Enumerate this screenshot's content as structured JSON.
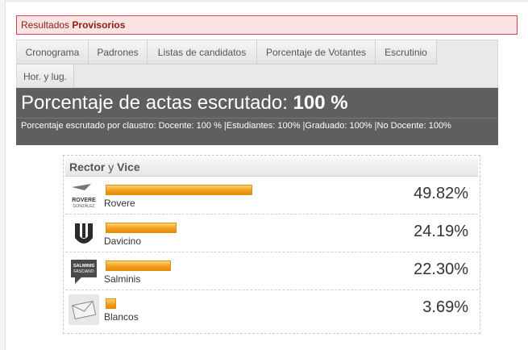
{
  "alert": {
    "prefix": "Resultados",
    "bold": "Provisorios"
  },
  "tabs": [
    {
      "label": "Cronograma"
    },
    {
      "label": "Padrones"
    },
    {
      "label": "Listas de candidatos"
    },
    {
      "label": "Porcentaje de Votantes"
    },
    {
      "label": "Escrutinio"
    },
    {
      "label": "Hor. y lug."
    }
  ],
  "summary": {
    "label": "Porcentaje de actas escrutado:",
    "value": "100 %",
    "detail": "Porcentaje escrutado por claustro: Docente: 100 % |Estudiantes: 100% |Graduado: 100% |No Docente: 100%"
  },
  "panel": {
    "title_a": "Rector",
    "title_conj": "y",
    "title_b": "Vice"
  },
  "colors": {
    "bar_accent": "#f4a01c",
    "header_bg": "#5f5f5f",
    "alert_border": "#d6454f"
  },
  "results": [
    {
      "name": "Rovere",
      "percent": "49.82%",
      "value": 49.82,
      "logo": "rovere-gonzalez-logo",
      "logo_text": [
        "ROVERE",
        "GONZÁLEZ"
      ]
    },
    {
      "name": "Davicino",
      "percent": "24.19%",
      "value": 24.19,
      "logo": "davicino-logo",
      "logo_text": []
    },
    {
      "name": "Salminis",
      "percent": "22.30%",
      "value": 22.3,
      "logo": "salminis-fasciano-logo",
      "logo_text": [
        "SALMINIS",
        "FASCIANO"
      ]
    },
    {
      "name": "Blancos",
      "percent": "3.69%",
      "value": 3.69,
      "logo": "envelope-icon",
      "logo_text": []
    }
  ]
}
